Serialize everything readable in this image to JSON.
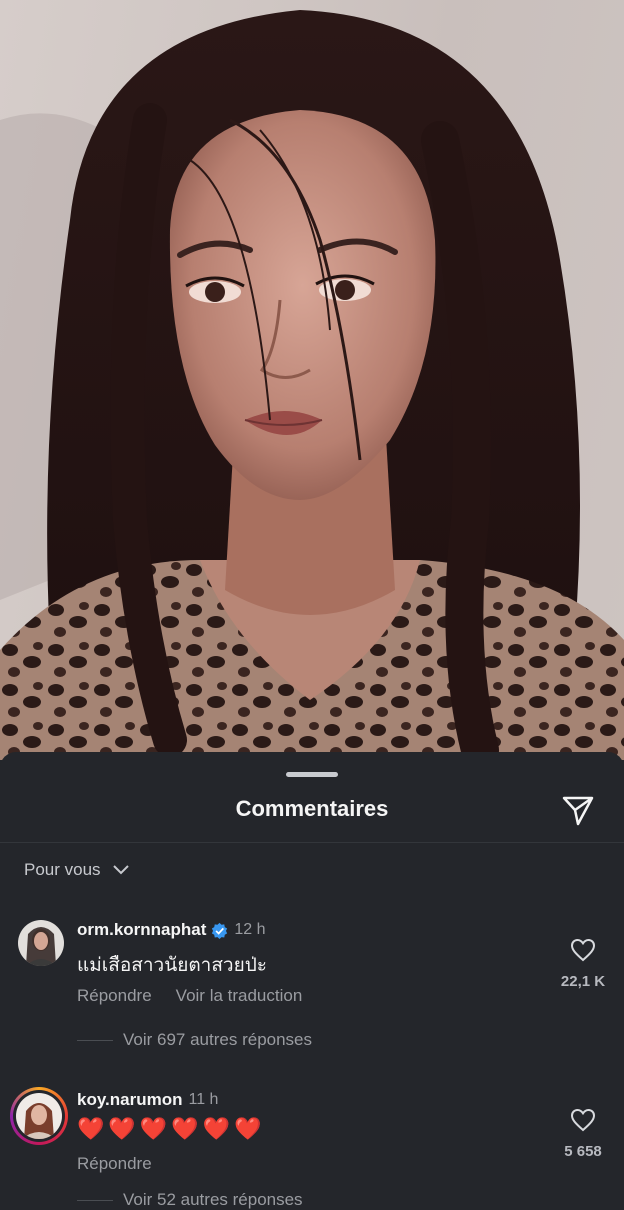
{
  "sheet": {
    "title": "Commentaires",
    "filter_label": "Pour vous"
  },
  "comments": [
    {
      "username": "orm.kornnaphat",
      "verified": true,
      "time": "12 h",
      "text": "แม่เสือสาวนัยตาสวยป่ะ",
      "reply_label": "Répondre",
      "translate_label": "Voir la traduction",
      "likes": "22,1 K",
      "more_replies": "Voir 697 autres réponses"
    },
    {
      "username": "koy.narumon",
      "time": "11 h",
      "text": "❤️❤️❤️❤️❤️❤️",
      "reply_label": "Répondre",
      "likes": "5 658",
      "more_replies": "Voir 52 autres réponses"
    }
  ],
  "icons": {
    "share": "paper-plane-icon",
    "chevron": "chevron-down-icon",
    "like": "heart-outline-icon",
    "verified": "verified-badge-icon"
  },
  "colors": {
    "background": "#24262b",
    "verified": "#3897f0",
    "heart": "#e8283a"
  }
}
